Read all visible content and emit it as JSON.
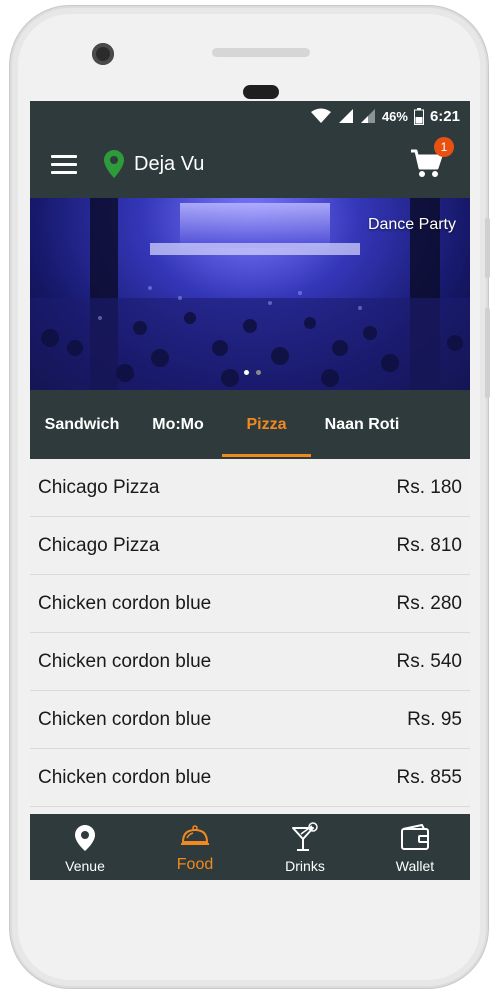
{
  "status_bar": {
    "battery": "46%",
    "time": "6:21"
  },
  "app_bar": {
    "venue_name": "Deja Vu",
    "cart_count": "1"
  },
  "banner": {
    "caption": "Dance Party"
  },
  "tabs": [
    {
      "label": "Sandwich"
    },
    {
      "label": "Mo:Mo"
    },
    {
      "label": "Pizza"
    },
    {
      "label": "Naan Roti"
    }
  ],
  "active_tab": "Pizza",
  "menu_items": [
    {
      "name": "Chicago Pizza",
      "price": "Rs. 180"
    },
    {
      "name": "Chicago Pizza",
      "price": "Rs. 810"
    },
    {
      "name": "Chicken cordon blue",
      "price": "Rs. 280"
    },
    {
      "name": "Chicken cordon blue",
      "price": "Rs. 540"
    },
    {
      "name": "Chicken cordon blue",
      "price": "Rs. 95"
    },
    {
      "name": "Chicken cordon blue",
      "price": "Rs. 855"
    }
  ],
  "bottom_nav": [
    {
      "label": "Venue",
      "icon": "location-pin-icon"
    },
    {
      "label": "Food",
      "icon": "food-cloche-icon"
    },
    {
      "label": "Drinks",
      "icon": "cocktail-icon"
    },
    {
      "label": "Wallet",
      "icon": "wallet-icon"
    }
  ],
  "colors": {
    "bar": "#2f3a3d",
    "accent": "#f08a1e",
    "badge": "#e8510f",
    "pin": "#2e9b3a"
  }
}
